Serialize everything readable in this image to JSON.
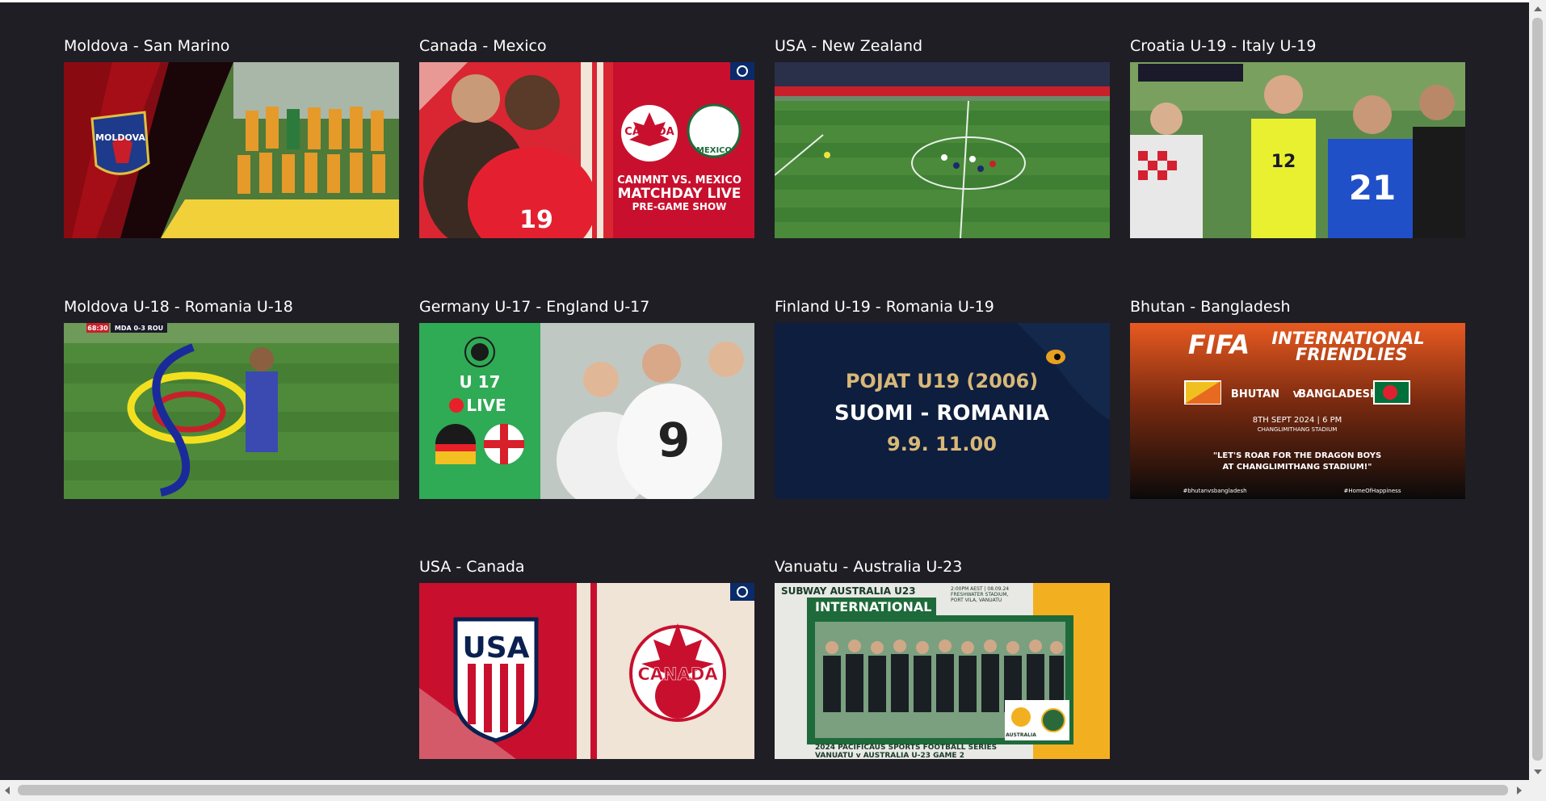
{
  "cards": [
    {
      "title": "Moldova - San Marino",
      "thumb_text": [
        "MOLDOVA"
      ]
    },
    {
      "title": "Canada - Mexico",
      "thumb_text": [
        "CANADA",
        "MEXICO",
        "CANMNT VS. MEXICO",
        "MATCHDAY LIVE",
        "PRE-GAME SHOW",
        "19"
      ]
    },
    {
      "title": "USA - New Zealand",
      "thumb_text": []
    },
    {
      "title": "Croatia U-19 - Italy U-19",
      "thumb_text": [
        "21",
        "12"
      ]
    },
    {
      "title": "Moldova U-18 - Romania U-18",
      "thumb_text": [
        "68:30",
        "MDA 0-3 ROU"
      ]
    },
    {
      "title": "Germany U-17 - England U-17",
      "thumb_text": [
        "U 17",
        "LIVE",
        "9"
      ]
    },
    {
      "title": "Finland U-19 - Romania U-19",
      "thumb_text": [
        "POJAT U19 (2006)",
        "SUOMI - ROMANIA",
        "9.9. 11.00"
      ]
    },
    {
      "title": "Bhutan - Bangladesh",
      "thumb_text": [
        "FIFA",
        "INTERNATIONAL",
        "FRIENDLIES",
        "BHUTAN",
        "V",
        "BANGLADESH",
        "8TH SEPT 2024 | 6 PM",
        "CHANGLIMITHANG STADIUM",
        "\"LET'S ROAR FOR THE DRAGON BOYS",
        "AT CHANGLIMITHANG STADIUM!\"",
        "#bhutanvsbangladesh",
        "#HomeOfHappiness"
      ]
    },
    {
      "title": "USA - Canada",
      "thumb_text": [
        "USA",
        "CANADA"
      ]
    },
    {
      "title": "Vanuatu - Australia U-23",
      "thumb_text": [
        "SUBWAY AUSTRALIA U23",
        "INTERNATIONAL",
        "2:00PM AEST | 08.09.24",
        "FRESHWATER STADIUM,",
        "PORT VILA, VANUATU",
        "2024 PACIFICAUS SPORTS FOOTBALL SERIES",
        "VANUATU v AUSTRALIA U-23 GAME 2",
        "AUSTRALIA"
      ]
    }
  ],
  "colors": {
    "background": "#1f1e24",
    "title_text": "#ffffff"
  }
}
